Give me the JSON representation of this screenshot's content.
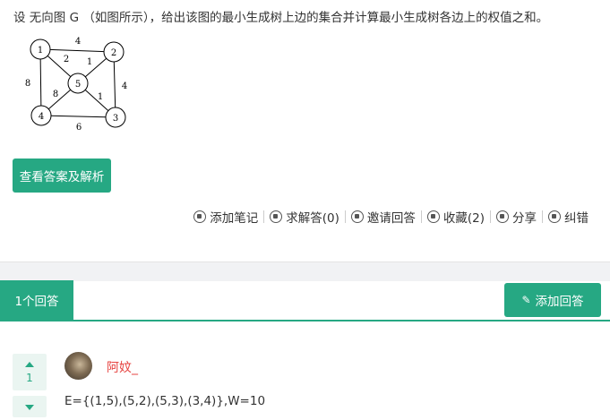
{
  "question": {
    "text": "设 无向图 G （如图所示），给出该图的最小生成树上边的集合并计算最小生成树各边上的权值之和。"
  },
  "graph": {
    "nodes": [
      "1",
      "2",
      "3",
      "4",
      "5"
    ],
    "edges": [
      {
        "from": "1",
        "to": "2",
        "weight": "4"
      },
      {
        "from": "1",
        "to": "4",
        "weight": "8"
      },
      {
        "from": "1",
        "to": "5",
        "weight": "2"
      },
      {
        "from": "2",
        "to": "5",
        "weight": "1"
      },
      {
        "from": "2",
        "to": "3",
        "weight": "4"
      },
      {
        "from": "5",
        "to": "3",
        "weight": "1"
      },
      {
        "from": "5",
        "to": "4",
        "weight": "8"
      },
      {
        "from": "4",
        "to": "3",
        "weight": "6"
      }
    ]
  },
  "answer_button": "查看答案及解析",
  "actions": [
    {
      "label": "添加笔记",
      "icon": "note-icon"
    },
    {
      "label": "求解答(0)",
      "icon": "comment-icon"
    },
    {
      "label": "邀请回答",
      "icon": "invite-icon"
    },
    {
      "label": "收藏(2)",
      "icon": "heart-icon"
    },
    {
      "label": "分享",
      "icon": "share-icon"
    },
    {
      "label": "纠错",
      "icon": "edit-icon"
    }
  ],
  "answers_tab": {
    "count_label": "1个回答",
    "add_button": "添加回答"
  },
  "answer": {
    "votes": "1",
    "username": "阿妏_",
    "content": "E={(1,5),(5,2),(5,3),(3,4)},W=10"
  },
  "colors": {
    "accent": "#26a883",
    "username": "#e64340"
  }
}
